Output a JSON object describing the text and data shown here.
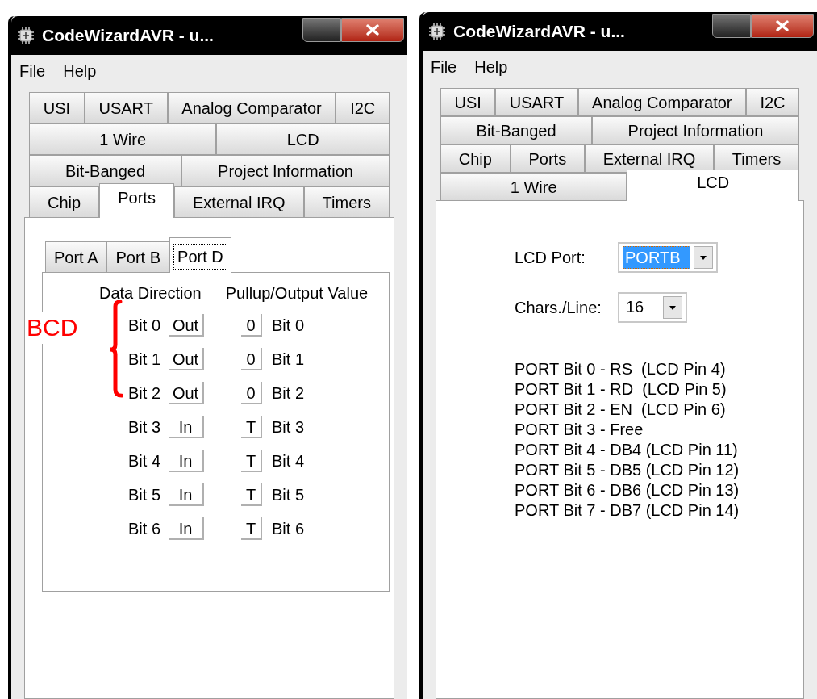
{
  "windows": [
    {
      "title": "CodeWizardAVR - u...",
      "menu": [
        "File",
        "Help"
      ],
      "tab_rows": [
        [
          {
            "label": "USI",
            "selected": false
          },
          {
            "label": "USART",
            "selected": false
          },
          {
            "label": "Analog Comparator",
            "selected": false
          },
          {
            "label": "I2C",
            "selected": false
          }
        ],
        [
          {
            "label": "1 Wire",
            "selected": false
          },
          {
            "label": "LCD",
            "selected": false
          }
        ],
        [
          {
            "label": "Bit-Banged",
            "selected": false
          },
          {
            "label": "Project Information",
            "selected": false
          }
        ],
        [
          {
            "label": "Chip",
            "selected": false
          },
          {
            "label": "Ports",
            "selected": true
          },
          {
            "label": "External IRQ",
            "selected": false
          },
          {
            "label": "Timers",
            "selected": false
          }
        ]
      ],
      "panel": {
        "kind": "ports",
        "port_tabs": [
          {
            "label": "Port A",
            "selected": false
          },
          {
            "label": "Port B",
            "selected": false
          },
          {
            "label": "Port D",
            "selected": true
          }
        ],
        "headers": [
          "Data Direction",
          "Pullup/Output Value"
        ],
        "annotation": "BCD",
        "bits": [
          {
            "label": "Bit 0",
            "direction": "Out",
            "value": "0",
            "value_label": "Bit 0",
            "bracketed": true
          },
          {
            "label": "Bit 1",
            "direction": "Out",
            "value": "0",
            "value_label": "Bit 1",
            "bracketed": true
          },
          {
            "label": "Bit 2",
            "direction": "Out",
            "value": "0",
            "value_label": "Bit 2",
            "bracketed": true
          },
          {
            "label": "Bit 3",
            "direction": "In",
            "value": "T",
            "value_label": "Bit 3",
            "bracketed": false
          },
          {
            "label": "Bit 4",
            "direction": "In",
            "value": "T",
            "value_label": "Bit 4",
            "bracketed": false
          },
          {
            "label": "Bit 5",
            "direction": "In",
            "value": "T",
            "value_label": "Bit 5",
            "bracketed": false
          },
          {
            "label": "Bit 6",
            "direction": "In",
            "value": "T",
            "value_label": "Bit 6",
            "bracketed": false
          }
        ]
      }
    },
    {
      "title": "CodeWizardAVR - u...",
      "menu": [
        "File",
        "Help"
      ],
      "tab_rows": [
        [
          {
            "label": "USI",
            "selected": false
          },
          {
            "label": "USART",
            "selected": false
          },
          {
            "label": "Analog Comparator",
            "selected": false
          },
          {
            "label": "I2C",
            "selected": false
          }
        ],
        [
          {
            "label": "Bit-Banged",
            "selected": false
          },
          {
            "label": "Project Information",
            "selected": false
          }
        ],
        [
          {
            "label": "Chip",
            "selected": false
          },
          {
            "label": "Ports",
            "selected": false
          },
          {
            "label": "External IRQ",
            "selected": false
          },
          {
            "label": "Timers",
            "selected": false
          }
        ],
        [
          {
            "label": "1 Wire",
            "selected": false
          },
          {
            "label": "LCD",
            "selected": true
          }
        ]
      ],
      "panel": {
        "kind": "lcd",
        "fields": [
          {
            "label": "LCD Port:",
            "value": "PORTB",
            "focused": true
          },
          {
            "label": "Chars./Line:",
            "value": "16",
            "focused": false
          }
        ],
        "pin_lines": [
          "PORT Bit 0 - RS  (LCD Pin 4)",
          "PORT Bit 1 - RD  (LCD Pin 5)",
          "PORT Bit 2 - EN  (LCD Pin 6)",
          "PORT Bit 3 - Free",
          "PORT Bit 4 - DB4 (LCD Pin 11)",
          "PORT Bit 5 - DB5 (LCD Pin 12)",
          "PORT Bit 6 - DB6 (LCD Pin 13)",
          "PORT Bit 7 - DB7 (LCD Pin 14)"
        ]
      }
    }
  ]
}
